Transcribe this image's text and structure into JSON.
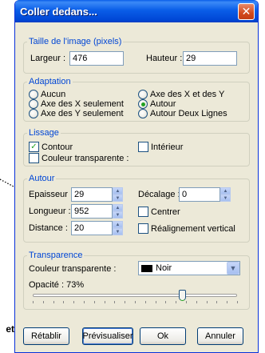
{
  "background_text": "et",
  "window": {
    "title": "Coller dedans...",
    "close_glyph": "✕"
  },
  "taille": {
    "legend": "Taille de l'image (pixels)",
    "largeur_label": "Largeur :",
    "largeur_value": "476",
    "hauteur_label": "Hauteur :",
    "hauteur_value": "29"
  },
  "adaptation": {
    "legend": "Adaptation",
    "options": [
      {
        "label": "Aucun",
        "checked": false
      },
      {
        "label": "Axe des X et des Y",
        "checked": false
      },
      {
        "label": "Axe des X seulement",
        "checked": false
      },
      {
        "label": "Autour",
        "checked": true
      },
      {
        "label": "Axe des Y seulement",
        "checked": false
      },
      {
        "label": "Autour Deux Lignes",
        "checked": false
      }
    ]
  },
  "lissage": {
    "legend": "Lissage",
    "contour_label": "Contour",
    "contour_checked": true,
    "interieur_label": "Intérieur",
    "interieur_checked": false,
    "couleur_label": "Couleur transparente :",
    "couleur_checked": false
  },
  "autour": {
    "legend": "Autour",
    "epaisseur_label": "Epaisseur :",
    "epaisseur_value": "29",
    "longueur_label": "Longueur :",
    "longueur_value": "952",
    "distance_label": "Distance :",
    "distance_value": "20",
    "decalage_label": "Décalage :",
    "decalage_value": "0",
    "centrer_label": "Centrer",
    "centrer_checked": false,
    "realignement_label": "Réalignement vertical",
    "realignement_checked": false
  },
  "transparence": {
    "legend": "Transparence",
    "couleur_label": "Couleur transparente :",
    "selected_color": "Noir",
    "opacite_label": "Opacité : 73%",
    "opacity": 0.73
  },
  "buttons": {
    "retablir": "Rétablir",
    "previsualiser": "Prévisualiser",
    "ok": "Ok",
    "annuler": "Annuler"
  },
  "colors": {
    "title_blue": "#0a5ee8",
    "legend_blue": "#0046d5",
    "dialog_bg": "#ece9d8"
  }
}
